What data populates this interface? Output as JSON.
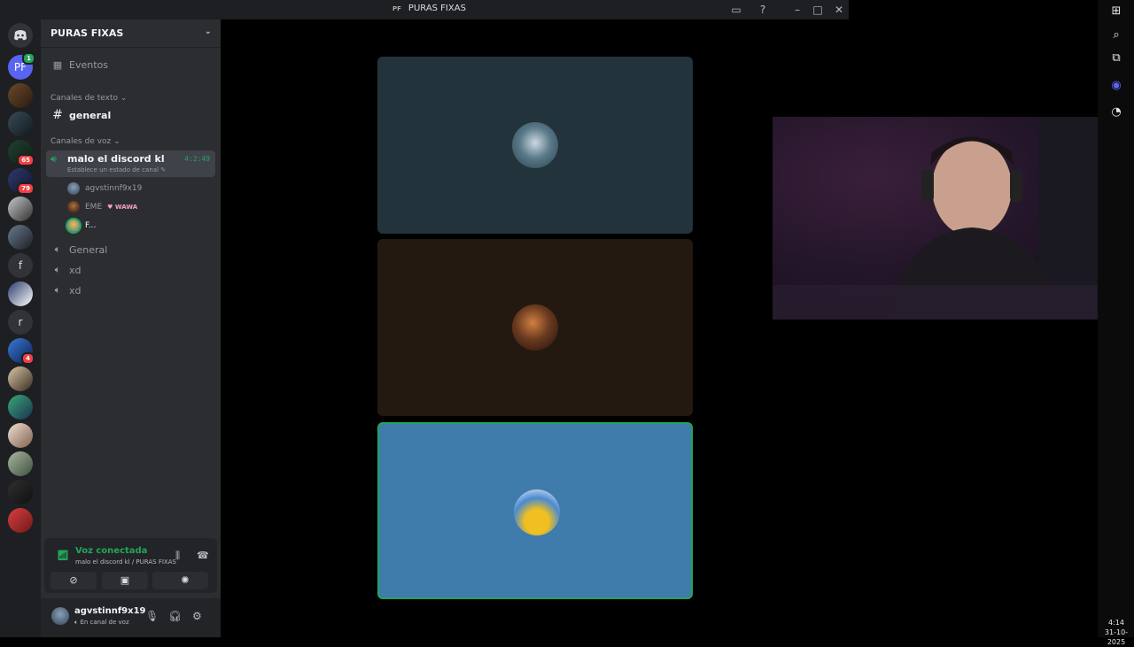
{
  "window": {
    "title": "PURAS FIXAS",
    "abbr": "PF"
  },
  "server": {
    "name": "PURAS FIXAS",
    "events_label": "Eventos",
    "text_category": "Canales de texto",
    "voice_category": "Canales de voz",
    "text_channels": [
      {
        "name": "general"
      }
    ],
    "active_voice": {
      "name": "malo el discord kl",
      "set_status": "Establece un estado de canal",
      "timer": "4:2:49",
      "members": [
        {
          "name": "agvstinnf9x19"
        },
        {
          "name": "EME",
          "tag": "WAWA"
        },
        {
          "name": "F..."
        }
      ]
    },
    "voice_channels": [
      {
        "name": "General"
      },
      {
        "name": "xd"
      },
      {
        "name": "xd"
      }
    ]
  },
  "rail": {
    "home_icon": "discord-icon",
    "servers": [
      {
        "label": "PF",
        "badge": "1"
      },
      {
        "badge": ""
      },
      {
        "badge": ""
      },
      {
        "badge": "65"
      },
      {
        "badge": "79"
      },
      {
        "badge": ""
      },
      {
        "badge": ""
      },
      {
        "label": "f",
        "badge": ""
      },
      {
        "badge": ""
      },
      {
        "label": "r",
        "badge": ""
      },
      {
        "badge": "4"
      },
      {
        "badge": ""
      },
      {
        "badge": ""
      },
      {
        "badge": ""
      },
      {
        "badge": ""
      },
      {
        "badge": ""
      },
      {
        "badge": ""
      }
    ]
  },
  "voice_panel": {
    "status": "Voz conectada",
    "location": "malo el discord kl / PURAS FIXAS"
  },
  "user": {
    "name": "agvstinnf9x19",
    "status": "En canal de voz"
  },
  "clock": {
    "time": "4:14",
    "date": "31-10-2025"
  },
  "colors": {
    "accent_green": "#23a55a",
    "tile1": "#22333b",
    "tile2": "#241911",
    "tile3": "#3f7bab",
    "sidebar": "#2b2d31",
    "rail": "#1e1f22"
  }
}
